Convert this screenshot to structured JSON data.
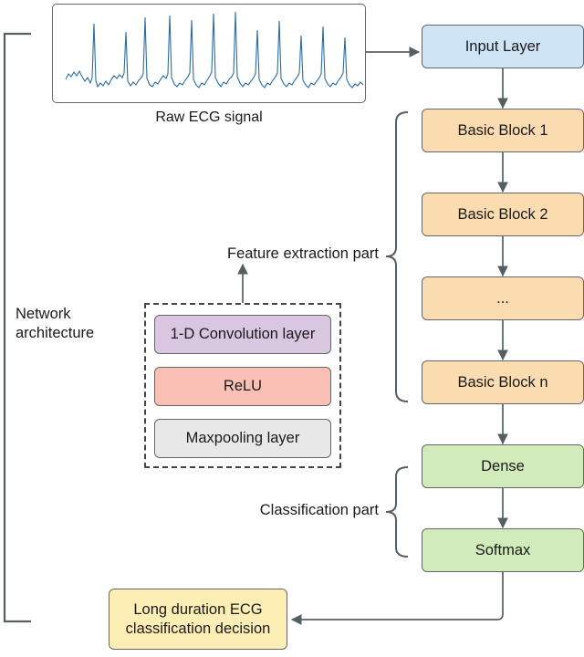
{
  "diagram": {
    "title_label": "Network\narchitecture",
    "ecg": {
      "caption": "Raw ECG signal",
      "signal_color": "#2b6ca3"
    },
    "brackets": {
      "feature_extraction_label": "Feature extraction part",
      "classification_label": "Classification part"
    },
    "pipeline": [
      {
        "id": "input",
        "label": "Input Layer",
        "color": "#cfe4f5"
      },
      {
        "id": "block1",
        "label": "Basic Block 1",
        "color": "#fbdcb0"
      },
      {
        "id": "block2",
        "label": "Basic Block 2",
        "color": "#fbdcb0"
      },
      {
        "id": "blockx",
        "label": "...",
        "color": "#fbdcb0"
      },
      {
        "id": "blockn",
        "label": "Basic Block n",
        "color": "#fbdcb0"
      },
      {
        "id": "dense",
        "label": "Dense",
        "color": "#d2ebbb"
      },
      {
        "id": "softmax",
        "label": "Softmax",
        "color": "#d2ebbb"
      }
    ],
    "basic_block_detail": [
      {
        "id": "conv",
        "label": "1-D Convolution layer",
        "color": "#d9c6e0"
      },
      {
        "id": "relu",
        "label": "ReLU",
        "color": "#fbc0b5"
      },
      {
        "id": "maxpool",
        "label": "Maxpooling layer",
        "color": "#e8e8e8"
      }
    ],
    "output": {
      "label": "Long duration ECG\nclassification decision",
      "color": "#fceeb4"
    }
  }
}
